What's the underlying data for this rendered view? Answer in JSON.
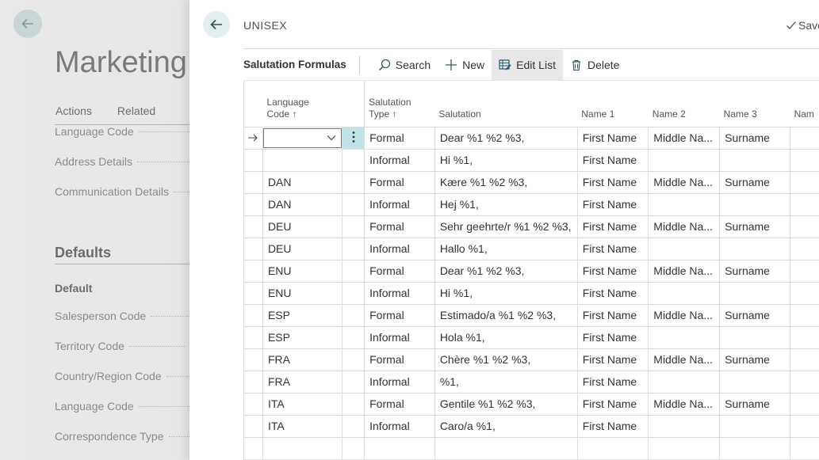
{
  "background": {
    "title": "Marketing",
    "actions": [
      "Actions",
      "Related"
    ],
    "fields_top": [
      "Language Code",
      "Address Details",
      "Communication Details"
    ],
    "section_heading": "Defaults",
    "sub_heading": "Default",
    "fields_bottom": [
      "Salesperson Code",
      "Territory Code",
      "Country/Region Code",
      "Language Code",
      "Correspondence Type"
    ]
  },
  "dialog": {
    "title": "UNISEX",
    "save_label": "Save"
  },
  "toolbar": {
    "title": "Salutation Formulas",
    "search_label": "Search",
    "new_label": "New",
    "edit_list_label": "Edit List",
    "delete_label": "Delete"
  },
  "table": {
    "headers": {
      "language_code": [
        "Language",
        "Code ↑"
      ],
      "salutation_type": [
        "Salutation",
        "Type ↑"
      ],
      "salutation": "Salutation",
      "name1": "Name 1",
      "name2": "Name 2",
      "name3": "Name 3",
      "name4": "Nam"
    },
    "rows": [
      {
        "lang": "",
        "type": "Formal",
        "salutation": "Dear %1 %2 %3,",
        "name1": "First Name",
        "name2": "Middle Na...",
        "name3": "Surname"
      },
      {
        "lang": "",
        "type": "Informal",
        "salutation": "Hi %1,",
        "name1": "First Name",
        "name2": "",
        "name3": ""
      },
      {
        "lang": "DAN",
        "type": "Formal",
        "salutation": "Kære %1 %2 %3,",
        "name1": "First Name",
        "name2": "Middle Na...",
        "name3": "Surname"
      },
      {
        "lang": "DAN",
        "type": "Informal",
        "salutation": "Hej %1,",
        "name1": "First Name",
        "name2": "",
        "name3": ""
      },
      {
        "lang": "DEU",
        "type": "Formal",
        "salutation": "Sehr geehrte/r %1 %2 %3,",
        "name1": "First Name",
        "name2": "Middle Na...",
        "name3": "Surname"
      },
      {
        "lang": "DEU",
        "type": "Informal",
        "salutation": "Hallo %1,",
        "name1": "First Name",
        "name2": "",
        "name3": ""
      },
      {
        "lang": "ENU",
        "type": "Formal",
        "salutation": "Dear %1 %2 %3,",
        "name1": "First Name",
        "name2": "Middle Na...",
        "name3": "Surname"
      },
      {
        "lang": "ENU",
        "type": "Informal",
        "salutation": "Hi %1,",
        "name1": "First Name",
        "name2": "",
        "name3": ""
      },
      {
        "lang": "ESP",
        "type": "Formal",
        "salutation": "Estimado/a %1 %2 %3,",
        "name1": "First Name",
        "name2": "Middle Na...",
        "name3": "Surname"
      },
      {
        "lang": "ESP",
        "type": "Informal",
        "salutation": "Hola %1,",
        "name1": "First Name",
        "name2": "",
        "name3": ""
      },
      {
        "lang": "FRA",
        "type": "Formal",
        "salutation": "Chère %1 %2 %3,",
        "name1": "First Name",
        "name2": "Middle Na...",
        "name3": "Surname"
      },
      {
        "lang": "FRA",
        "type": "Informal",
        "salutation": "%1,",
        "name1": "First Name",
        "name2": "",
        "name3": ""
      },
      {
        "lang": "ITA",
        "type": "Formal",
        "salutation": "Gentile %1 %2 %3,",
        "name1": "First Name",
        "name2": "Middle Na...",
        "name3": "Surname"
      },
      {
        "lang": "ITA",
        "type": "Informal",
        "salutation": "Caro/a %1,",
        "name1": "First Name",
        "name2": "",
        "name3": ""
      }
    ]
  }
}
